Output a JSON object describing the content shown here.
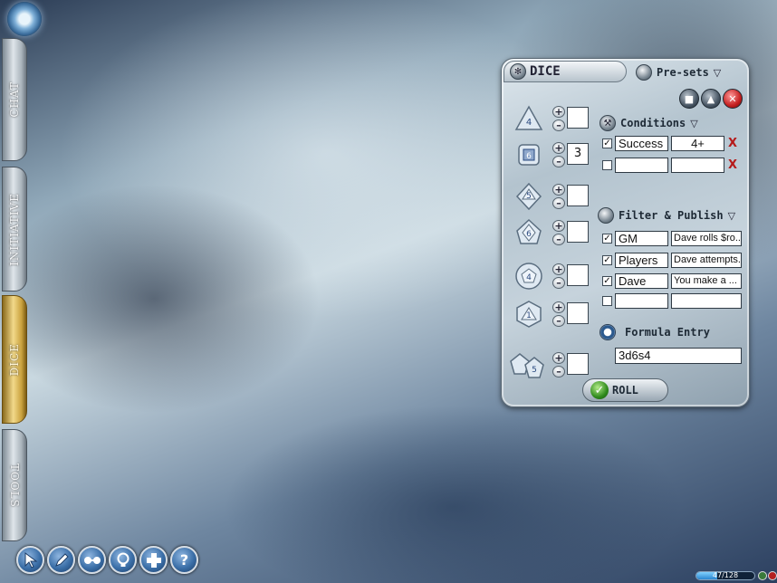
{
  "side_tabs": [
    {
      "label": "CHAT"
    },
    {
      "label": "INITIATIVE"
    },
    {
      "label": "DICE"
    },
    {
      "label": "TOOLS"
    }
  ],
  "bottom_tools": [
    {
      "icon": "pointer-icon"
    },
    {
      "icon": "pencil-icon"
    },
    {
      "icon": "glasses-icon"
    },
    {
      "icon": "lightbulb-icon"
    },
    {
      "icon": "grid-icon"
    },
    {
      "icon": "help-icon",
      "glyph": "?"
    }
  ],
  "status": {
    "text": "47/128",
    "fraction": 0.367
  },
  "panel": {
    "title": "DICE",
    "presets_label": "Pre-sets",
    "dice": [
      {
        "icon": "d4-icon",
        "face": "4",
        "count": ""
      },
      {
        "icon": "d6-icon",
        "face": "6",
        "count": "3"
      },
      {
        "icon": "d8-icon",
        "face": "5",
        "count": ""
      },
      {
        "icon": "d10-icon",
        "face": "6",
        "count": ""
      },
      {
        "icon": "d12-icon",
        "face": "4",
        "count": ""
      },
      {
        "icon": "d20-icon",
        "face": "1",
        "count": ""
      },
      {
        "icon": "d100-icon",
        "face": "5",
        "count": ""
      }
    ],
    "conditions": {
      "label": "Conditions",
      "rows": [
        {
          "checked": true,
          "name": "Success",
          "value": "4+"
        },
        {
          "checked": false,
          "name": "",
          "value": ""
        }
      ]
    },
    "filter": {
      "label": "Filter & Publish",
      "rows": [
        {
          "checked": true,
          "target": "GM",
          "message": "Dave rolls $ro..."
        },
        {
          "checked": true,
          "target": "Players",
          "message": "Dave attempts..."
        },
        {
          "checked": true,
          "target": "Dave",
          "message": "You make a ..."
        },
        {
          "checked": false,
          "target": "",
          "message": ""
        }
      ]
    },
    "formula": {
      "label": "Formula Entry",
      "value": "3d6s4"
    },
    "roll_label": "ROLL"
  }
}
